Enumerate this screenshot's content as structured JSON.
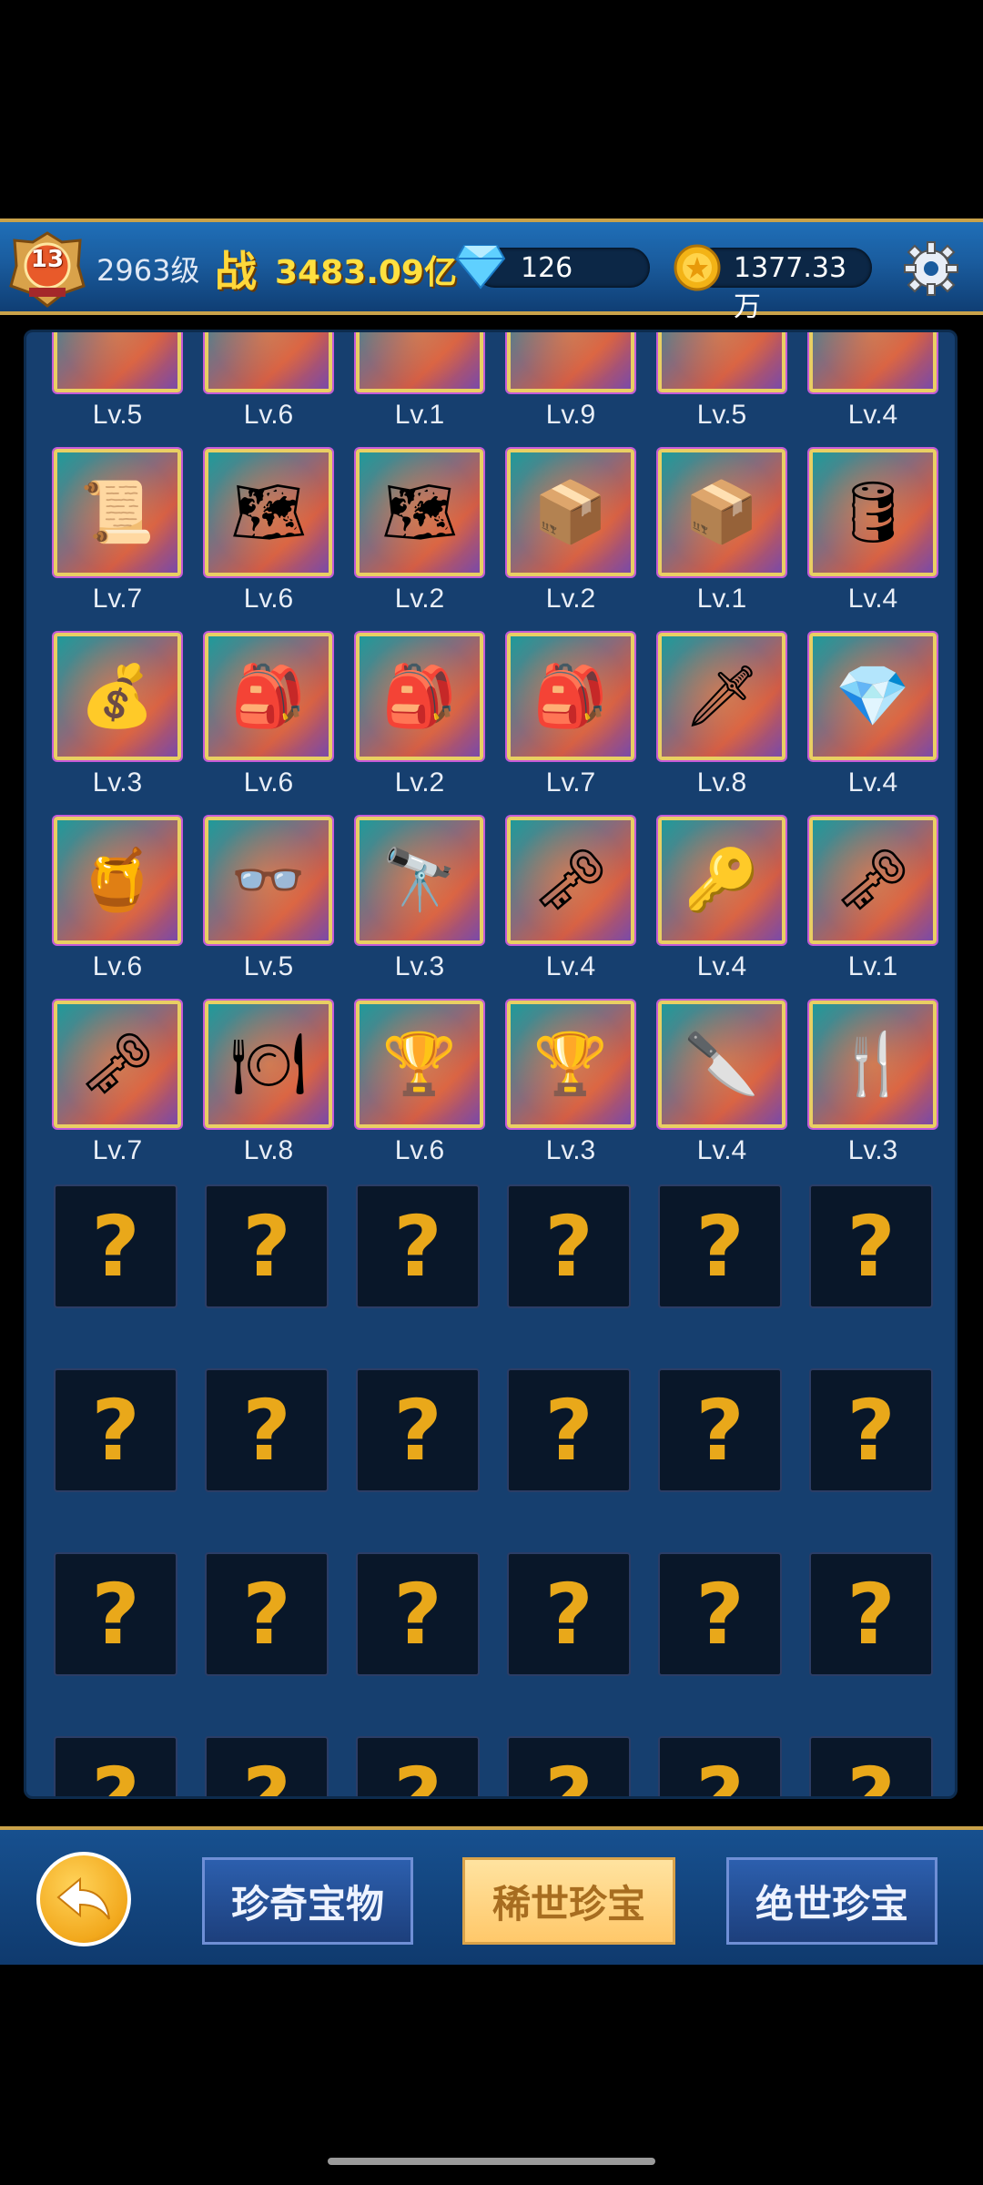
{
  "header": {
    "player_level_badge": "13",
    "level_text": "2963级",
    "power_label": "战",
    "power_value": "3483.09亿",
    "diamonds": "126",
    "gold": "1377.33万",
    "icons": {
      "diamond": "diamond-icon",
      "gold": "gold-coin-icon",
      "settings": "gear-icon"
    }
  },
  "items": [
    {
      "icon": "",
      "level": "Lv.5"
    },
    {
      "icon": "",
      "level": "Lv.6"
    },
    {
      "icon": "",
      "level": "Lv.1"
    },
    {
      "icon": "",
      "level": "Lv.9"
    },
    {
      "icon": "",
      "level": "Lv.5"
    },
    {
      "icon": "",
      "level": "Lv.4"
    },
    {
      "icon": "scroll-icon",
      "level": "Lv.7"
    },
    {
      "icon": "map-piece-icon",
      "level": "Lv.6"
    },
    {
      "icon": "map-piece-icon",
      "level": "Lv.2"
    },
    {
      "icon": "crate-icon",
      "level": "Lv.2"
    },
    {
      "icon": "crate-icon",
      "level": "Lv.1"
    },
    {
      "icon": "barrel-icon",
      "level": "Lv.4"
    },
    {
      "icon": "sack-icon",
      "level": "Lv.3"
    },
    {
      "icon": "backpack-icon",
      "level": "Lv.6"
    },
    {
      "icon": "backpack-icon",
      "level": "Lv.2"
    },
    {
      "icon": "backpack-icon",
      "level": "Lv.7"
    },
    {
      "icon": "blade-icon",
      "level": "Lv.8"
    },
    {
      "icon": "gems-icon",
      "level": "Lv.4"
    },
    {
      "icon": "honeycomb-icon",
      "level": "Lv.6"
    },
    {
      "icon": "glasses-icon",
      "level": "Lv.5"
    },
    {
      "icon": "spyglass-icon",
      "level": "Lv.3"
    },
    {
      "icon": "skull-key-icon",
      "level": "Lv.4"
    },
    {
      "icon": "key-icon",
      "level": "Lv.4"
    },
    {
      "icon": "skull-key-icon",
      "level": "Lv.1"
    },
    {
      "icon": "skull-key-icon",
      "level": "Lv.7"
    },
    {
      "icon": "plate-icon",
      "level": "Lv.8"
    },
    {
      "icon": "goblet-icon",
      "level": "Lv.6"
    },
    {
      "icon": "goblet-icon",
      "level": "Lv.3"
    },
    {
      "icon": "knife-icon",
      "level": "Lv.4"
    },
    {
      "icon": "fork-icon",
      "level": "Lv.3"
    }
  ],
  "locked_symbol": "?",
  "locked_count": 24,
  "tabs": [
    {
      "label": "珍奇宝物",
      "active": false
    },
    {
      "label": "稀世珍宝",
      "active": true
    },
    {
      "label": "绝世珍宝",
      "active": false
    }
  ],
  "colors": {
    "accent_gold": "#ffe040",
    "locked_question": "#e9a81a",
    "active_tab": "#ffc86a"
  }
}
